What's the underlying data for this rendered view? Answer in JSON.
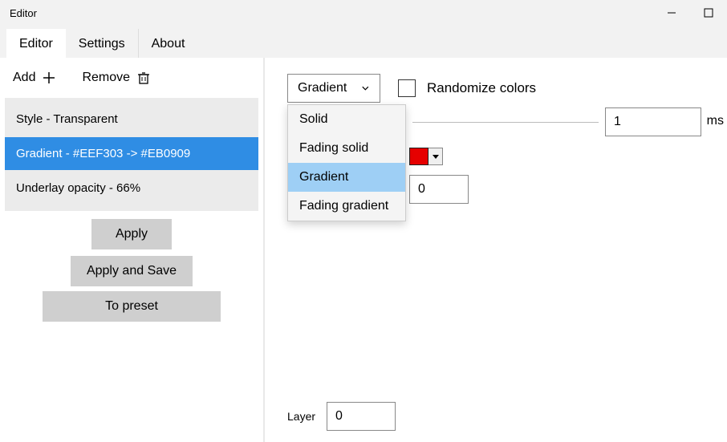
{
  "window": {
    "title": "Editor"
  },
  "tabs": {
    "editor": "Editor",
    "settings": "Settings",
    "about": "About"
  },
  "sidebar": {
    "add_label": "Add",
    "remove_label": "Remove",
    "items": [
      "Style - Transparent",
      "Gradient - #EEF303 -> #EB0909",
      "Underlay opacity - 66%"
    ],
    "apply": "Apply",
    "apply_save": "Apply and Save",
    "to_preset": "To preset"
  },
  "main": {
    "select_value": "Gradient",
    "randomize_label": "Randomize colors",
    "dropdown": {
      "solid": "Solid",
      "fading_solid": "Fading solid",
      "gradient": "Gradient",
      "fading_gradient": "Fading gradient"
    },
    "duration_value": "1",
    "duration_unit": "ms",
    "mid_value": "0",
    "layer_label": "Layer",
    "layer_value": "0",
    "color_hex": "#e60000"
  }
}
